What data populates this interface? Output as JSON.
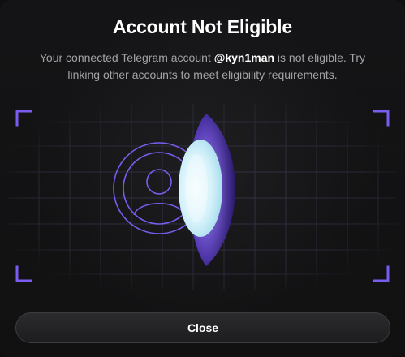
{
  "dialog": {
    "title": "Account Not Eligible",
    "description_prefix": "Your connected Telegram account ",
    "username": "@kyn1man",
    "description_suffix": " is not eligible. Try linking other accounts to meet eligibility requirements.",
    "close_label": "Close"
  },
  "illustration": {
    "icon": "user-scan-icon",
    "accent_color": "#7b5cf0",
    "glow_color": "#d9f3ff"
  },
  "colors": {
    "background": "#111112",
    "title": "#ffffff",
    "text": "#a2a3a7",
    "button_border": "#3c3c40"
  }
}
